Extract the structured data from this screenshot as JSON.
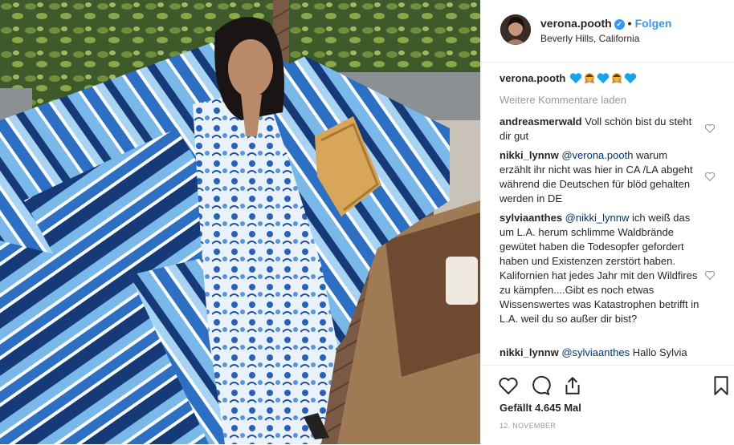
{
  "post": {
    "username": "verona.pooth",
    "follow_label": "Folgen",
    "location": "Beverly Hills, California",
    "caption_user": "verona.pooth",
    "caption_emojis": [
      "blue-heart",
      "person-hands",
      "blue-heart",
      "person-hands",
      "blue-heart"
    ],
    "load_more": "Weitere Kommentare laden",
    "likes": "Gefällt 4.645 Mal",
    "date": "12. NOVEMBER"
  },
  "comments": [
    {
      "user": "andreasmerwald",
      "mention": "",
      "text": "Voll schön bist du steht dir gut"
    },
    {
      "user": "nikki_lynnw",
      "mention": "@verona.pooth",
      "text": "warum erzählt ihr nicht was hier in CA /LA abgeht während die Deutschen für blöd gehalten werden in DE"
    },
    {
      "user": "sylviaanthes",
      "mention": "@nikki_lynnw",
      "text": "ich weiß das um L.A. herum schlimme Waldbrände gewütet haben die Todesopfer gefordert haben und Existenzen zerstört haben. Kalifornien hat jedes Jahr mit den Wildfires zu kämpfen....Gibt es noch etwas Wissenswertes was Katastrophen betrifft in L.A. weil du so außer dir bist?"
    },
    {
      "user": "nikki_lynnw",
      "mention": "@sylviaanthes",
      "text": "Hallo Sylvia"
    }
  ],
  "colors": {
    "accent": "#3897f0",
    "mention": "#003569",
    "muted": "#999999"
  }
}
